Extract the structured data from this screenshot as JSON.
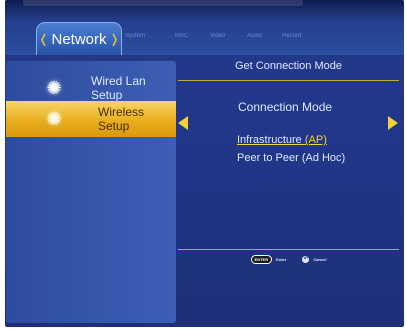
{
  "header": {
    "active_tab": "Network",
    "tabs": [
      "System",
      "MSC",
      "Video",
      "Audio",
      "Record"
    ]
  },
  "sidebar": {
    "items": [
      {
        "label": "Wired Lan Setup",
        "selected": false
      },
      {
        "label": "Wireless Setup",
        "selected": true
      }
    ]
  },
  "main": {
    "title": "Get Connection Mode",
    "field_label": "Connection Mode",
    "options": {
      "infrastructure": "Infrastructure",
      "infrastructure_suffix": " (AP)",
      "p2p": "Peer to Peer (Ad Hoc)"
    }
  },
  "footer": {
    "enter_key": "ENTER",
    "enter_label": "Enter",
    "cancel_label": "Cancel"
  },
  "colors": {
    "background": "#22378a",
    "highlight": "#e9ae1d",
    "accent": "#f2d236"
  }
}
